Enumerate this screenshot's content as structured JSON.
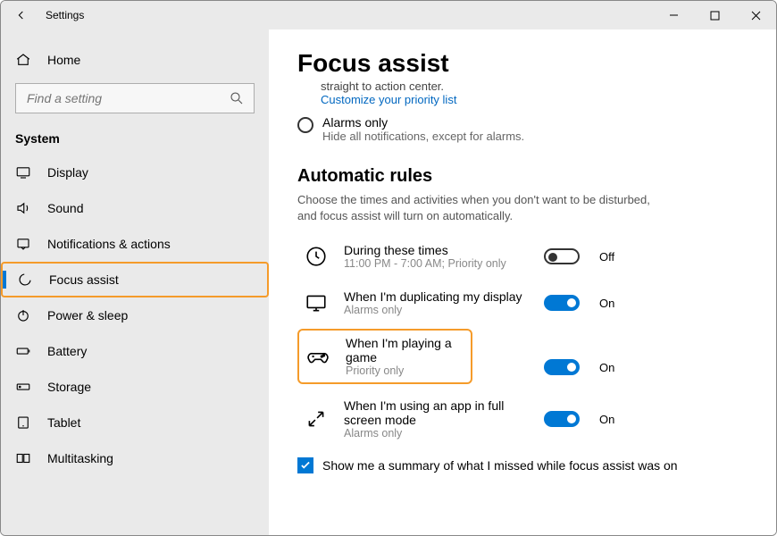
{
  "title": "Settings",
  "sidebar": {
    "home": "Home",
    "search_placeholder": "Find a setting",
    "section": "System",
    "items": [
      {
        "label": "Display"
      },
      {
        "label": "Sound"
      },
      {
        "label": "Notifications & actions"
      },
      {
        "label": "Focus assist"
      },
      {
        "label": "Power & sleep"
      },
      {
        "label": "Battery"
      },
      {
        "label": "Storage"
      },
      {
        "label": "Tablet"
      },
      {
        "label": "Multitasking"
      }
    ]
  },
  "main": {
    "page_title": "Focus assist",
    "snippet": "straight to action center.",
    "link": "Customize your priority list",
    "alarms_title": "Alarms only",
    "alarms_sub": "Hide all notifications, except for alarms.",
    "rules_title": "Automatic rules",
    "rules_desc": "Choose the times and activities when you don't want to be disturbed, and focus assist will turn on automatically.",
    "rules": [
      {
        "title": "During these times",
        "sub": "11:00 PM - 7:00 AM; Priority only",
        "state": "Off"
      },
      {
        "title": "When I'm duplicating my display",
        "sub": "Alarms only",
        "state": "On"
      },
      {
        "title": "When I'm playing a game",
        "sub": "Priority only",
        "state": "On"
      },
      {
        "title": "When I'm using an app in full screen mode",
        "sub": "Alarms only",
        "state": "On"
      }
    ],
    "summary_checkbox": "Show me a summary of what I missed while focus assist was on"
  }
}
